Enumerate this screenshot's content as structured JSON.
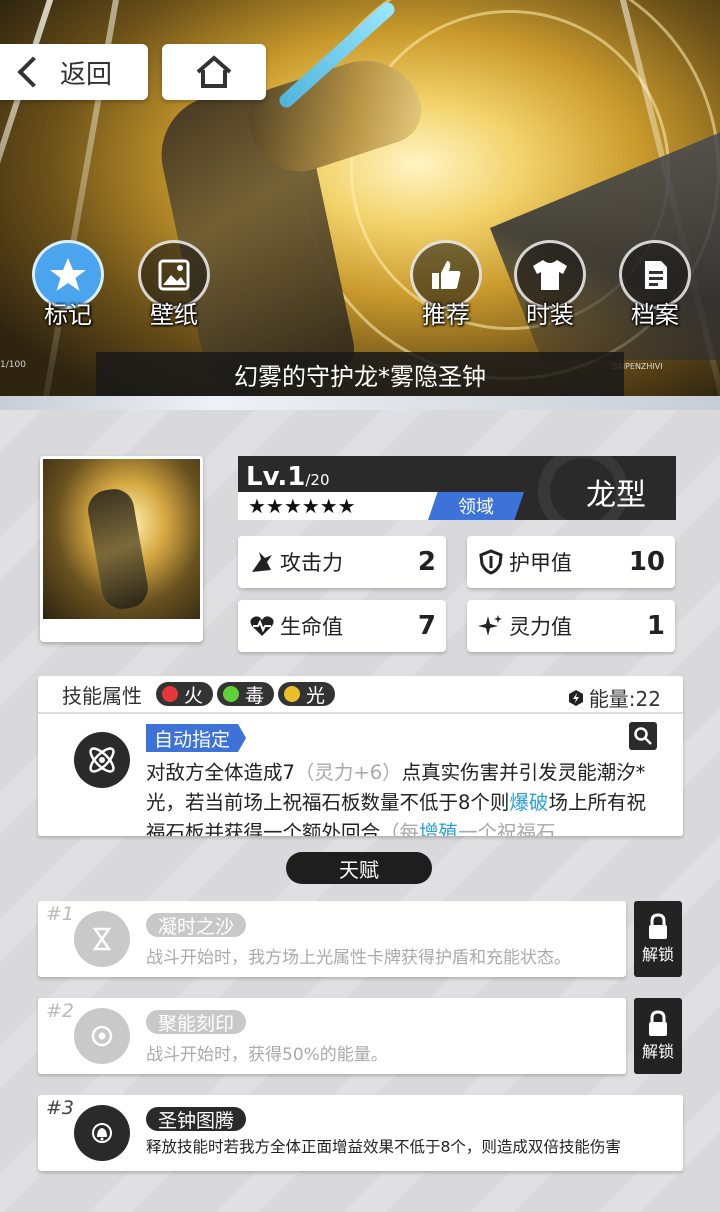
{
  "nav": {
    "back_label": "返回"
  },
  "hero": {
    "actions": [
      {
        "label": "标记",
        "icon": "star-icon",
        "active": true
      },
      {
        "label": "壁纸",
        "icon": "image-icon",
        "active": false
      },
      {
        "label": "推荐",
        "icon": "thumbs-up-icon",
        "active": false
      },
      {
        "label": "时装",
        "icon": "shirt-icon",
        "active": false
      },
      {
        "label": "档案",
        "icon": "document-icon",
        "active": false
      }
    ],
    "card_name": "幻雾的守护龙*雾隐圣钟",
    "deco_left": "1/100",
    "deco_right": "SAIPENZHIVI"
  },
  "card": {
    "level_prefix": "Lv.1",
    "level_max": "/20",
    "stars": "★★★★★★",
    "domain_label": "领域",
    "type_label": "龙型",
    "stats": {
      "attack": {
        "label": "攻击力",
        "value": "2"
      },
      "armor": {
        "label": "护甲值",
        "value": "10"
      },
      "hp": {
        "label": "生命值",
        "value": "7"
      },
      "spirit": {
        "label": "灵力值",
        "value": "1"
      }
    }
  },
  "skill": {
    "attr_label": "技能属性",
    "elements": [
      {
        "label": "火",
        "color": "#e5383b"
      },
      {
        "label": "毒",
        "color": "#5fcf3a"
      },
      {
        "label": "光",
        "color": "#e8c02c"
      }
    ],
    "energy_label": "能量:22",
    "auto_tag": "自动指定",
    "desc_1": "对敌方全体造成7",
    "desc_dim": "（灵力+6）",
    "desc_2": "点真实伤害并引发灵能潮汐*光，若当前场上祝福石板数量不低于8个则",
    "desc_hl": "爆破",
    "desc_3": "场上所有祝福石板并获得一个额外回合",
    "desc_dim2": "（每",
    "desc_hl2": "增殖",
    "desc_4": "一个祝福石"
  },
  "talents": {
    "title": "天赋",
    "items": [
      {
        "num": "#1",
        "name": "凝时之沙",
        "desc": "战斗开始时，我方场上光属性卡牌获得护盾和充能状态。",
        "locked": true
      },
      {
        "num": "#2",
        "name": "聚能刻印",
        "desc": "战斗开始时，获得50%的能量。",
        "locked": true
      },
      {
        "num": "#3",
        "name": "圣钟图腾",
        "desc": "释放技能时若我方全体正面增益效果不低于8个，则造成双倍技能伤害",
        "locked": false
      }
    ],
    "unlock_label": "解锁"
  },
  "colors": {
    "accent_blue": "#3d73d9",
    "highlight": "#2aa0e0",
    "dark": "#2a2a2a"
  }
}
